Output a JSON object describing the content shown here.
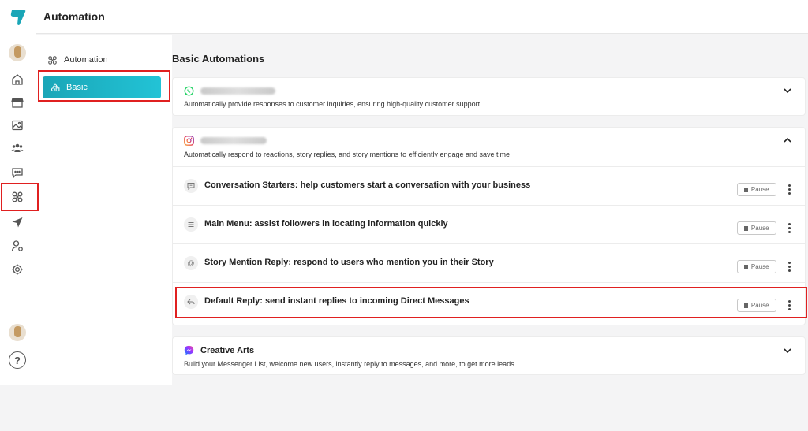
{
  "topbar": {
    "title": "Automation"
  },
  "subnav": {
    "items": [
      {
        "label": "Automation",
        "icon": "automation-icon"
      },
      {
        "label": "Basic",
        "icon": "shapes-icon",
        "active": true
      }
    ]
  },
  "rail": {
    "items": [
      "home-icon",
      "store-icon",
      "image-icon",
      "users-icon",
      "chat-icon",
      "automation-icon",
      "send-icon",
      "user-settings-icon",
      "gear-icon"
    ],
    "active": "automation-icon",
    "help": "?"
  },
  "main": {
    "title": "Basic Automations",
    "cards": [
      {
        "platform": "whatsapp-icon",
        "desc": "Automatically provide responses to customer inquiries, ensuring high-quality customer support.",
        "expanded": false
      },
      {
        "platform": "instagram-icon",
        "desc": "Automatically respond to reactions, story replies, and story mentions to efficiently engage and save time",
        "expanded": true,
        "rows": [
          {
            "icon": "message-icon",
            "text": "Conversation Starters: help customers start a conversation with your business",
            "action": "Pause"
          },
          {
            "icon": "menu-icon",
            "text": "Main Menu: assist followers in locating information quickly",
            "action": "Pause"
          },
          {
            "icon": "at-icon",
            "text": "Story Mention Reply: respond to users who mention you in their Story",
            "action": "Pause"
          },
          {
            "icon": "reply-icon",
            "text": "Default Reply: send instant replies to incoming Direct Messages",
            "action": "Pause"
          }
        ]
      },
      {
        "platform": "messenger-icon",
        "title": "Creative Arts",
        "desc": "Build your Messenger List, welcome new users, instantly reply to messages, and more, to get more leads",
        "expanded": false
      }
    ]
  },
  "colors": {
    "accent": "#1aa6b7",
    "highlight": "#e02020"
  }
}
